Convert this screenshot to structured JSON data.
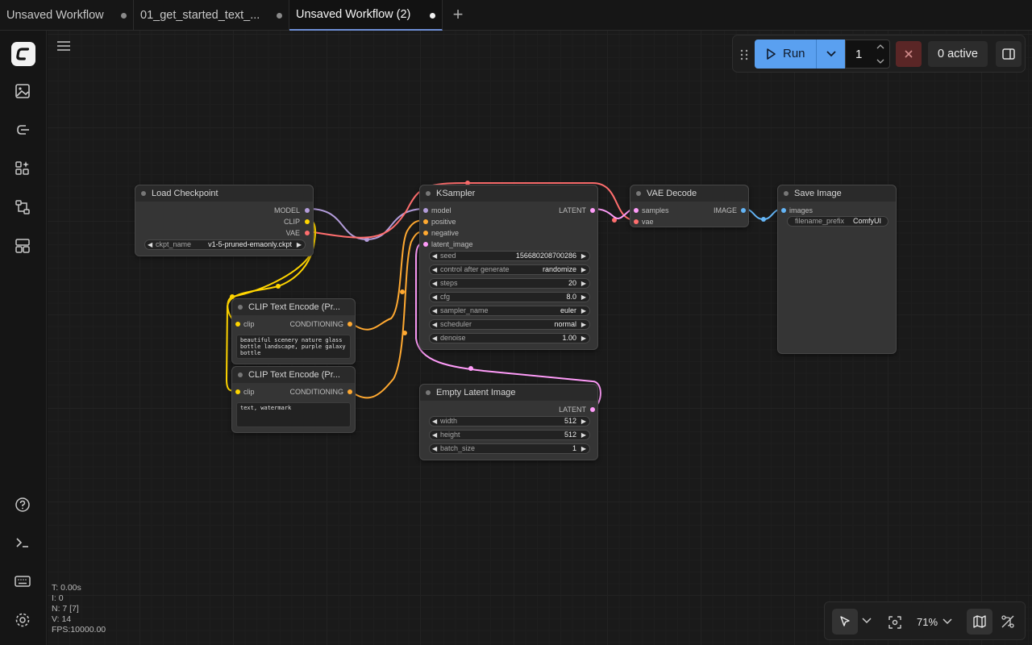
{
  "tabs": [
    {
      "label": "Unsaved Workflow",
      "active": false
    },
    {
      "label": "01_get_started_text_...",
      "active": false
    },
    {
      "label": "Unsaved Workflow (2)",
      "active": true
    }
  ],
  "sidebar": {
    "items": [
      "images-icon",
      "models-icon",
      "node-library-icon",
      "workflows-icon",
      "templates-icon"
    ],
    "bottom": [
      "help-icon",
      "console-icon",
      "keyboard-icon",
      "settings-icon"
    ]
  },
  "runbar": {
    "run_label": "Run",
    "batch_count": "1",
    "active_label": "0 active"
  },
  "stats": {
    "t": "T: 0.00s",
    "i": "I: 0",
    "n": "N: 7 [7]",
    "v": "V: 14",
    "fps": "FPS:10000.00"
  },
  "zoom": {
    "level": "71%"
  },
  "colors": {
    "model": "#b39ddb",
    "clip": "#ffd500",
    "vae": "#ff6e6e",
    "conditioning": "#ffa931",
    "latent": "#ff9cf9",
    "image": "#64b5f6",
    "run": "#5aa0f0"
  },
  "nodes": {
    "load_checkpoint": {
      "title": "Load Checkpoint",
      "outputs": [
        "MODEL",
        "CLIP",
        "VAE"
      ],
      "ckpt_label": "ckpt_name",
      "ckpt_value": "v1-5-pruned-emaonly.ckpt"
    },
    "clip_pos": {
      "title": "CLIP Text Encode (Pr...",
      "input": "clip",
      "output": "CONDITIONING",
      "text": "beautiful scenery nature glass bottle landscape, purple galaxy bottle"
    },
    "clip_neg": {
      "title": "CLIP Text Encode (Pr...",
      "input": "clip",
      "output": "CONDITIONING",
      "text": "text, watermark"
    },
    "ksampler": {
      "title": "KSampler",
      "inputs": [
        "model",
        "positive",
        "negative",
        "latent_image"
      ],
      "output": "LATENT",
      "widgets": [
        {
          "label": "seed",
          "value": "156680208700286"
        },
        {
          "label": "control after generate",
          "value": "randomize"
        },
        {
          "label": "steps",
          "value": "20"
        },
        {
          "label": "cfg",
          "value": "8.0"
        },
        {
          "label": "sampler_name",
          "value": "euler"
        },
        {
          "label": "scheduler",
          "value": "normal"
        },
        {
          "label": "denoise",
          "value": "1.00"
        }
      ]
    },
    "empty_latent": {
      "title": "Empty Latent Image",
      "output": "LATENT",
      "widgets": [
        {
          "label": "width",
          "value": "512"
        },
        {
          "label": "height",
          "value": "512"
        },
        {
          "label": "batch_size",
          "value": "1"
        }
      ]
    },
    "vae_decode": {
      "title": "VAE Decode",
      "inputs": [
        "samples",
        "vae"
      ],
      "output": "IMAGE"
    },
    "save_image": {
      "title": "Save Image",
      "input": "images",
      "prefix_label": "filename_prefix",
      "prefix_value": "ComfyUI"
    }
  }
}
